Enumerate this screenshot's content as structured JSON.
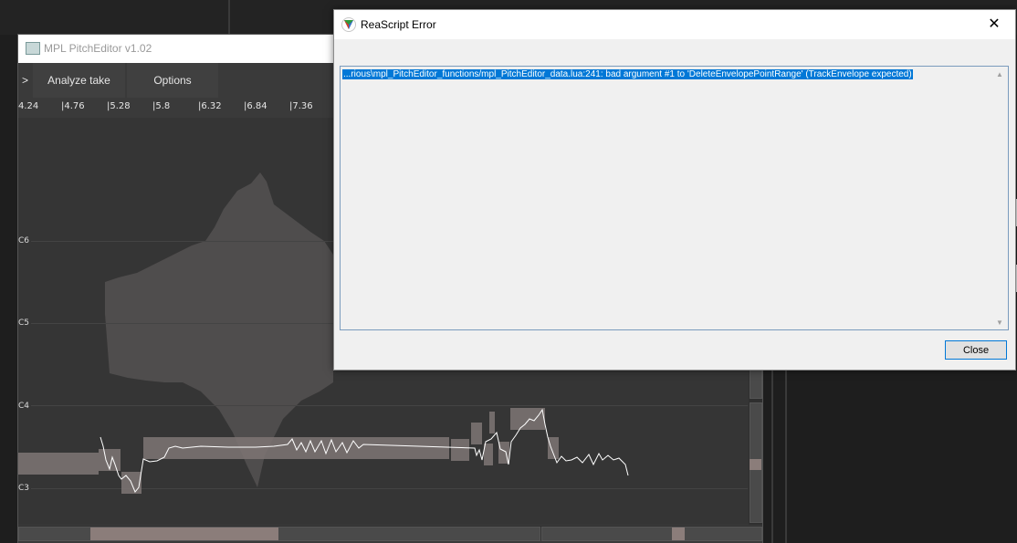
{
  "editor": {
    "title": "MPL PitchEditor v1.02",
    "toolbar": {
      "arrow_label": ">",
      "analyze_label": "Analyze take",
      "options_label": "Options"
    },
    "ruler_ticks": [
      "4.24",
      "|4.76",
      "|5.28",
      "|5.8",
      "|6.32",
      "|6.84",
      "|7.36"
    ],
    "note_labels": [
      "C6",
      "C5",
      "C4",
      "C3"
    ]
  },
  "dialog": {
    "title": "ReaScript Error",
    "close_x": "✕",
    "error_message": "...rious\\mpl_PitchEditor_functions/mpl_PitchEditor_data.lua:241: bad argument #1 to 'DeleteEnvelopePointRange' (TrackEnvelope expected)",
    "close_button_label": "Close",
    "scroll_up": "▲",
    "scroll_down": "▼"
  },
  "colors": {
    "selection": "#0078d7",
    "note_block": "#7e7674",
    "editor_bg": "#353535"
  },
  "icons": {
    "editor_icon": "window-icon",
    "dialog_icon": "reaper-logo-icon"
  }
}
